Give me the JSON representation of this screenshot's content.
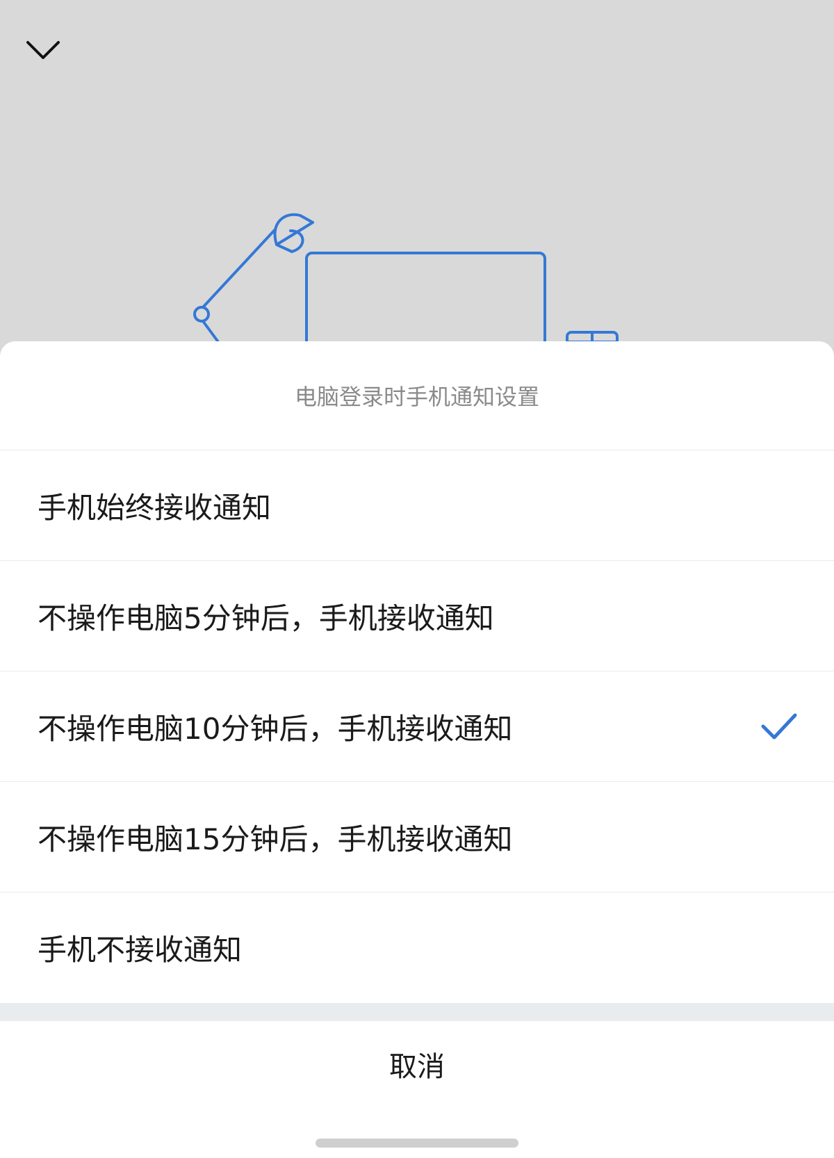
{
  "header": {
    "back_icon": "chevron-down-icon",
    "illustration_icon": "desk-lamp-computer-illustration"
  },
  "sheet": {
    "title": "电脑登录时手机通知设置",
    "options": [
      {
        "label": "手机始终接收通知",
        "selected": false
      },
      {
        "label": "不操作电脑5分钟后，手机接收通知",
        "selected": false
      },
      {
        "label": "不操作电脑10分钟后，手机接收通知",
        "selected": true
      },
      {
        "label": "不操作电脑15分钟后，手机接收通知",
        "selected": false
      },
      {
        "label": "手机不接收通知",
        "selected": false
      }
    ],
    "cancel_label": "取消",
    "check_icon": "checkmark-icon"
  },
  "colors": {
    "accent": "#3478d6",
    "background_dim": "#d9d9d9",
    "sheet_bg": "#ffffff",
    "title_text": "#8a8a8a",
    "primary_text": "#1a1a1a"
  }
}
